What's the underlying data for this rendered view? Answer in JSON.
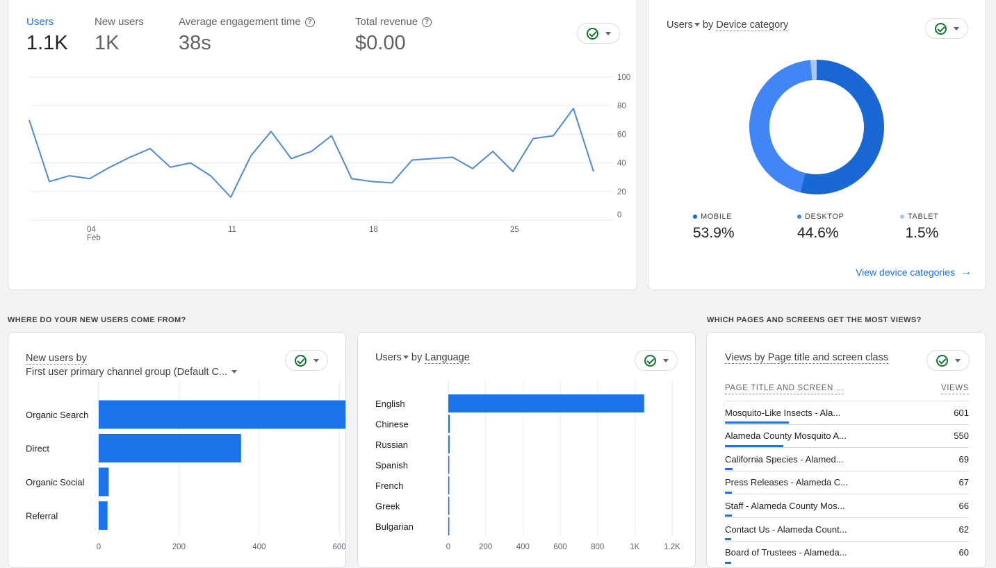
{
  "overview": {
    "metrics": [
      {
        "label": "Users",
        "value": "1.1K"
      },
      {
        "label": "New users",
        "value": "1K"
      },
      {
        "label": "Average engagement time",
        "value": "38s"
      },
      {
        "label": "Total revenue",
        "value": "$0.00"
      }
    ],
    "help_icon": "?"
  },
  "device": {
    "title_metric": "Users",
    "title_mid": " by ",
    "title_dim": "Device category",
    "link": "View device categories",
    "arrow": "→"
  },
  "sections": {
    "new_users": "WHERE DO YOUR NEW USERS COME FROM?",
    "pages": "WHICH PAGES AND SCREENS GET THE MOST VIEWS?"
  },
  "channel": {
    "title_line1": "New users by",
    "title_line2": "First user primary channel group (Default C..."
  },
  "language": {
    "title_metric": "Users",
    "title_mid": " by ",
    "title_dim": "Language"
  },
  "pages": {
    "title": "Views by Page title and screen class",
    "col_page": "PAGE TITLE AND SCREEN ...",
    "col_views": "VIEWS",
    "rows": [
      {
        "page": "Mosquito-Like Insects - Ala...",
        "views": "601",
        "share": 1.0
      },
      {
        "page": "Alameda County Mosquito A...",
        "views": "550",
        "share": 0.915
      },
      {
        "page": "California Species - Alamed...",
        "views": "69",
        "share": 0.115
      },
      {
        "page": "Press Releases - Alameda C...",
        "views": "67",
        "share": 0.111
      },
      {
        "page": "Staff - Alameda County Mos...",
        "views": "66",
        "share": 0.11
      },
      {
        "page": "Contact Us - Alameda Count...",
        "views": "62",
        "share": 0.103
      },
      {
        "page": "Board of Trustees - Alameda...",
        "views": "60",
        "share": 0.1
      }
    ]
  },
  "colors": {
    "primary": "#1a73e8",
    "mobile": "#1967d2",
    "desktop": "#4285f4",
    "tablet": "#a8c7fa",
    "line": "#4a8ad8"
  },
  "chart_data": [
    {
      "type": "line",
      "y": [
        70,
        27,
        31,
        29,
        37,
        44,
        50,
        37,
        40,
        31,
        16,
        45,
        62,
        43,
        48,
        59,
        29,
        27,
        26,
        42,
        43,
        44,
        36,
        48,
        34,
        57,
        59,
        78,
        34
      ],
      "x_ticks": [
        {
          "index": 3,
          "label": "04",
          "sub": "Feb"
        },
        {
          "index": 10,
          "label": "11",
          "sub": ""
        },
        {
          "index": 17,
          "label": "18",
          "sub": ""
        },
        {
          "index": 24,
          "label": "25",
          "sub": ""
        }
      ],
      "y_ticks": [
        0,
        20,
        40,
        60,
        80,
        100
      ],
      "ylim": [
        0,
        100
      ],
      "grid": true
    },
    {
      "type": "pie",
      "donut": true,
      "slices": [
        {
          "label": "MOBILE",
          "value": 53.9,
          "display": "53.9%",
          "color": "#1967d2"
        },
        {
          "label": "DESKTOP",
          "value": 44.6,
          "display": "44.6%",
          "color": "#4285f4"
        },
        {
          "label": "TABLET",
          "value": 1.5,
          "display": "1.5%",
          "color": "#a8c7fa"
        }
      ]
    },
    {
      "type": "bar",
      "orientation": "horizontal",
      "categories": [
        "Organic Search",
        "Direct",
        "Organic Social",
        "Referral"
      ],
      "values": [
        620,
        355,
        25,
        22
      ],
      "x_ticks": [
        "0",
        "200",
        "400",
        "600"
      ],
      "tick_values": [
        0,
        200,
        400,
        600
      ],
      "xlim": [
        0,
        780
      ]
    },
    {
      "type": "bar",
      "orientation": "horizontal",
      "categories": [
        "English",
        "Chinese",
        "Russian",
        "Spanish",
        "French",
        "Greek",
        "Bulgarian"
      ],
      "values": [
        1050,
        8,
        7,
        3,
        2,
        2,
        2
      ],
      "x_ticks": [
        "0",
        "200",
        "400",
        "600",
        "800",
        "1K",
        "1.2K"
      ],
      "tick_values": [
        0,
        200,
        400,
        600,
        800,
        1000,
        1200
      ],
      "xlim": [
        0,
        1200
      ]
    }
  ]
}
